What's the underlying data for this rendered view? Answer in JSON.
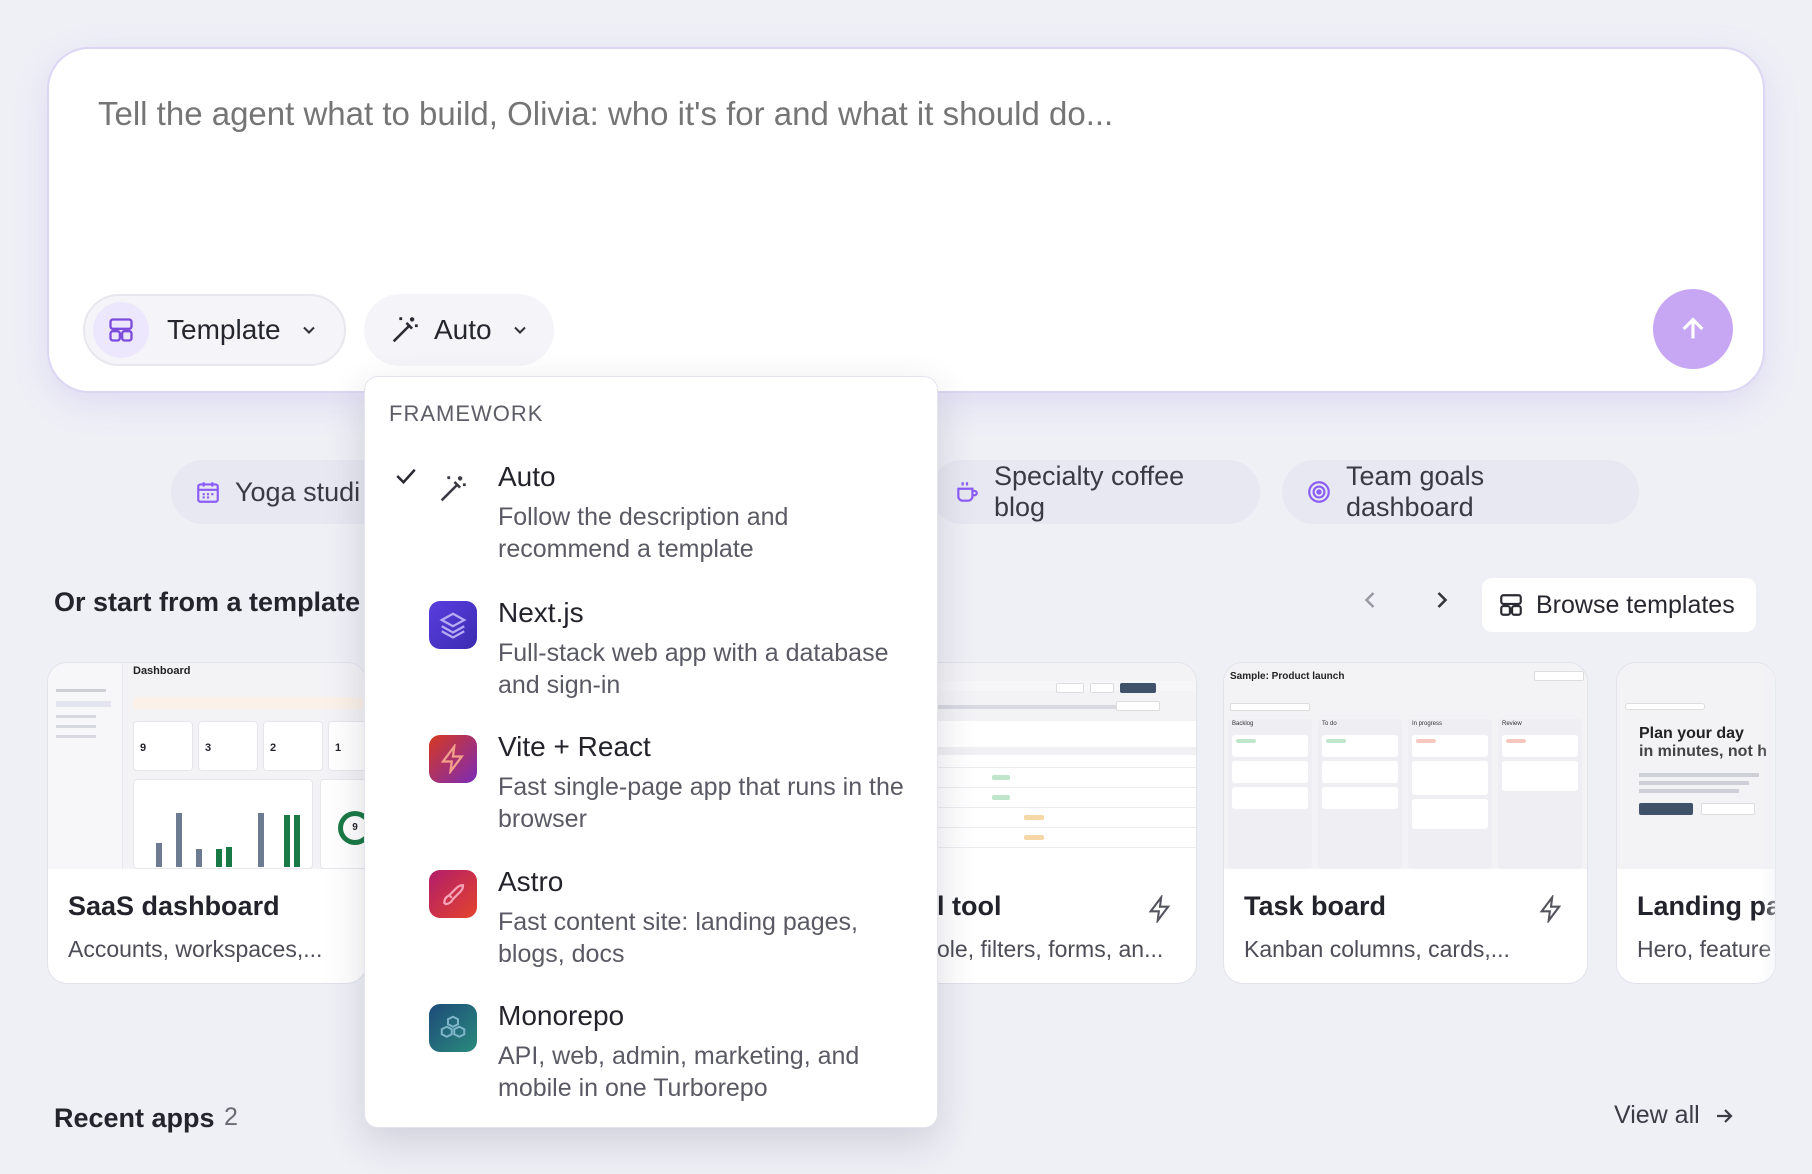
{
  "prompt": {
    "placeholder": "Tell the agent what to build, Olivia: who it's for and what it should do...",
    "template_chip": "Template",
    "framework_chip": "Auto"
  },
  "suggestions": [
    {
      "label": "Yoga studi",
      "icon": "calendar-icon"
    },
    {
      "label": "Specialty coffee blog",
      "icon": "coffee-cup-icon"
    },
    {
      "label": "Team goals dashboard",
      "icon": "target-icon"
    }
  ],
  "templates_section": {
    "title": "Or start from a template",
    "browse_label": "Browse templates",
    "cards": [
      {
        "title": "SaaS dashboard",
        "desc": "Accounts, workspaces,..."
      },
      {
        "title": "l tool",
        "desc": "ole, filters, forms, an..."
      },
      {
        "title": "Task board",
        "desc": "Kanban columns, cards,..."
      },
      {
        "title": "Landing pa",
        "desc": "Hero, feature"
      }
    ],
    "thumbs": {
      "saas": {
        "heading": "Dashboard",
        "stats": [
          "9",
          "3",
          "2",
          "1"
        ],
        "donut_value": "9"
      },
      "task": {
        "heading": "Sample: Product launch",
        "columns": [
          "Backlog",
          "To do",
          "In progress",
          "Review"
        ]
      },
      "landing": {
        "heading_line1": "Plan your day",
        "heading_line2": "in minutes, not h"
      }
    }
  },
  "recent_apps": {
    "title": "Recent apps",
    "count": "2",
    "view_all": "View all"
  },
  "framework_menu": {
    "heading": "FRAMEWORK",
    "items": [
      {
        "name": "Auto",
        "desc": "Follow the description and recommend a template",
        "selected": true
      },
      {
        "name": "Next.js",
        "desc": "Full-stack web app with a database and sign-in"
      },
      {
        "name": "Vite + React",
        "desc": "Fast single-page app that runs in the browser"
      },
      {
        "name": "Astro",
        "desc": "Fast content site: landing pages, blogs, docs"
      },
      {
        "name": "Monorepo",
        "desc": "API, web, admin, marketing, and mobile in one Turborepo"
      }
    ]
  },
  "colors": {
    "accent": "#c7a6f3",
    "page_bg": "#eff0f6",
    "icon_purple": "#8b5cf6"
  }
}
